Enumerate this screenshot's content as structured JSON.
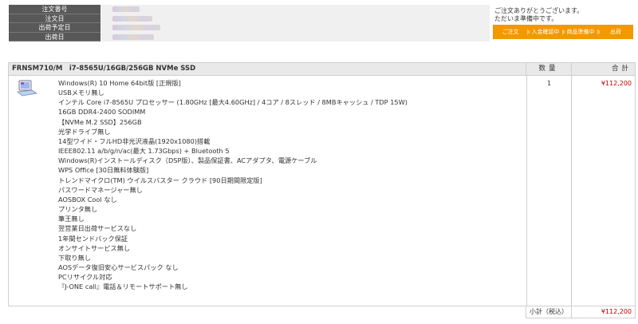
{
  "order_info": {
    "rows": [
      {
        "label": "注文番号"
      },
      {
        "label": "注文日"
      },
      {
        "label": "出荷予定日"
      },
      {
        "label": "出荷日"
      }
    ]
  },
  "status": {
    "thanks_line1": "ご注文ありがとうございます。",
    "thanks_line2": "ただいま準備中です。",
    "steps": [
      "ご注文",
      "入金確認中",
      "商品準備中",
      "出荷"
    ]
  },
  "product": {
    "name": "FRNSM710/M　i7-8565U/16GB/256GB NVMe SSD",
    "qty_header": "数量",
    "total_header": "合計",
    "quantity": "1",
    "total": "¥112,200",
    "specs": [
      "Windows(R) 10 Home 64bit版 [正規版]",
      "USBメモリ無し",
      "インテル Core i7-8565U プロセッサー (1.80GHz [最大4.60GHz] / 4コア / 8スレッド / 8MBキャッシュ / TDP 15W)",
      "16GB DDR4-2400 SODIMM",
      "【NVMe M.2 SSD】256GB",
      "光学ドライブ無し",
      "14型ワイド・フルHD非光沢液晶(1920x1080)搭載",
      "IEEE802.11 a/b/g/n/ac(最大 1.73Gbps) + Bluetooth 5",
      "Windows(R)インストールディスク（DSP版）、製品保証書、ACアダプタ、電源ケーブル",
      "WPS Office [30日無料体験版]",
      "トレンドマイクロ(TM) ウイルスバスター クラウド [90日期間限定版]",
      "パスワードマネージャー無し",
      "AOSBOX Cool なし",
      "プリンタ無し",
      "筆王無し",
      "翌営業日出荷サービスなし",
      "1年間センドバック保証",
      "オンサイトサービス無し",
      "下取り無し",
      "AOSデータ復旧安心サービスパック なし",
      "PCリサイクル対応",
      "『J-ONE call』電話＆リモートサポート無し"
    ]
  },
  "subtotal": {
    "label": "小計（税込）",
    "value": "¥112,200"
  },
  "colors": {
    "label_bg": "#585858",
    "accent_orange": "#f39800",
    "price_red": "#c00000"
  }
}
